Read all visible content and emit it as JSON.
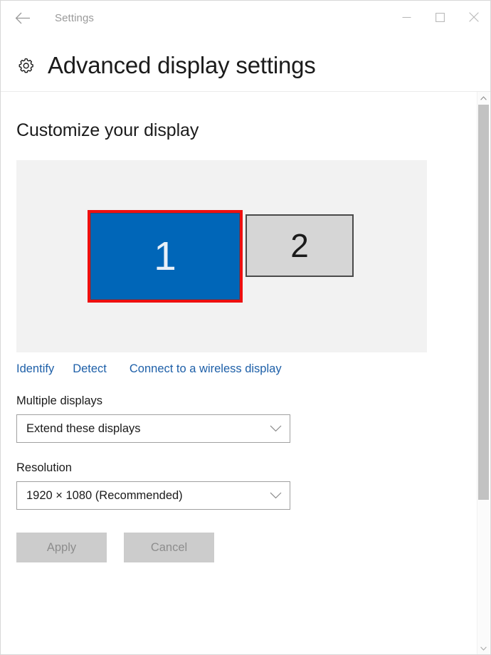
{
  "titlebar": {
    "back_label": "Back",
    "app_title": "Settings",
    "minimize_label": "Minimize",
    "maximize_label": "Maximize",
    "close_label": "Close"
  },
  "header": {
    "icon": "gear-icon",
    "title": "Advanced display settings"
  },
  "main": {
    "section_title": "Customize your display",
    "displays": [
      {
        "number": "1",
        "state": "selected",
        "fill": "#0066b8",
        "highlight": "#ee1010"
      },
      {
        "number": "2",
        "state": "unselected",
        "fill": "#d6d6d6",
        "border": "#4a4a4a"
      }
    ],
    "links": [
      {
        "label": "Identify",
        "name": "identify-link"
      },
      {
        "label": "Detect",
        "name": "detect-link"
      },
      {
        "label": "Connect to a wireless display",
        "name": "connect-wireless-display-link"
      }
    ],
    "multiple_displays": {
      "label": "Multiple displays",
      "value": "Extend these displays"
    },
    "resolution": {
      "label": "Resolution",
      "value": "1920 × 1080 (Recommended)"
    },
    "buttons": {
      "apply": "Apply",
      "cancel": "Cancel"
    }
  },
  "colors": {
    "link": "#1d5fa8",
    "accent_blue": "#0066b8",
    "selection_red": "#ee1010",
    "panel_bg": "#f2f2f2"
  }
}
